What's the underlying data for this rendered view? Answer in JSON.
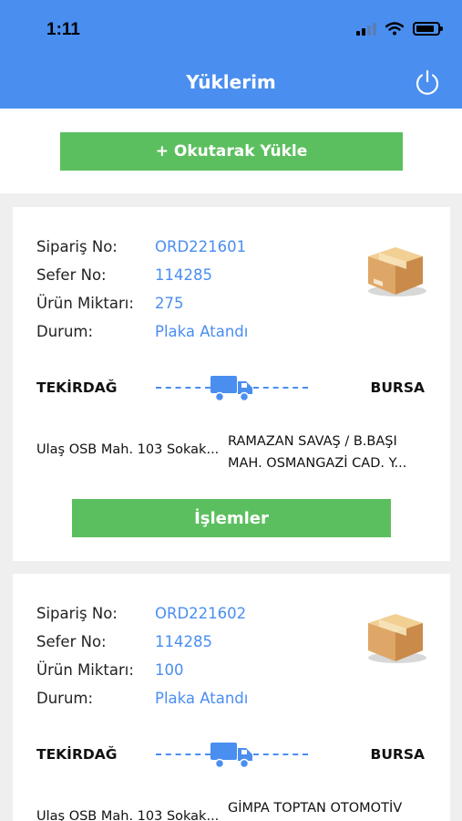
{
  "status_bar": {
    "time": "1:11"
  },
  "header": {
    "title": "Yüklerim",
    "power_icon": "power-icon"
  },
  "scan_button_label": "+ Okutarak Yükle",
  "colors": {
    "primary": "#4a8ef0",
    "button_green": "#5cbf5f"
  },
  "labels": {
    "order_no": "Sipariş No:",
    "trip_no": "Sefer No:",
    "quantity": "Ürün Miktarı:",
    "status": "Durum:"
  },
  "orders": [
    {
      "order_no": "ORD221601",
      "trip_no": "114285",
      "quantity": "275",
      "status": "Plaka Atandı",
      "from_city": "TEKİRDAĞ",
      "to_city": "BURSA",
      "from_address": "Ulaş OSB Mah. 103 Sokak...",
      "to_address_line1": "RAMAZAN SAVAŞ / B.BAŞI",
      "to_address_line2": "MAH. OSMANGAZİ CAD. Y...",
      "action_label": "İşlemler"
    },
    {
      "order_no": "ORD221602",
      "trip_no": "114285",
      "quantity": "100",
      "status": "Plaka Atandı",
      "from_city": "TEKİRDAĞ",
      "to_city": "BURSA",
      "from_address": "Ulaş OSB Mah. 103 Sokak...",
      "to_address_line1": "GİMPA TOPTAN OTOMOTİV"
    }
  ]
}
